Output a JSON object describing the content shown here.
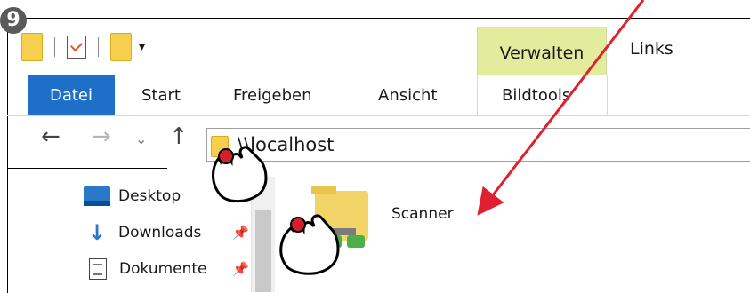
{
  "step": {
    "number": "9"
  },
  "quick_access": {
    "icons": [
      "folder-icon",
      "properties-icon",
      "new-folder-icon"
    ],
    "customize": "▾"
  },
  "context": {
    "tab_label": "Verwalten",
    "window_title": "Links",
    "tab_color": "#e3eb9c"
  },
  "ribbon": {
    "tabs": [
      {
        "label": "Datei"
      },
      {
        "label": "Start"
      },
      {
        "label": "Freigeben"
      },
      {
        "label": "Ansicht"
      },
      {
        "label": "Bildtools"
      }
    ],
    "file_tab_color": "#1e6fc7"
  },
  "nav": {
    "back": "←",
    "forward": "→",
    "recent": "⌄",
    "up": "↑"
  },
  "address": {
    "value": "\\\\localhost"
  },
  "sidebar": {
    "items": [
      {
        "label": "Desktop",
        "icon": "desktop-icon",
        "pin": "📌"
      },
      {
        "label": "Downloads",
        "icon": "downloads-icon",
        "pin": "📌"
      },
      {
        "label": "Dokumente",
        "icon": "documents-icon",
        "pin": "📌"
      }
    ],
    "scroll_up": "^"
  },
  "content": {
    "items": [
      {
        "label": "Scanner",
        "icon": "shared-folder-network-icon"
      }
    ]
  },
  "annotations": {
    "arrow_color": "#e0202e",
    "click_marker_color": "#d5202a"
  }
}
